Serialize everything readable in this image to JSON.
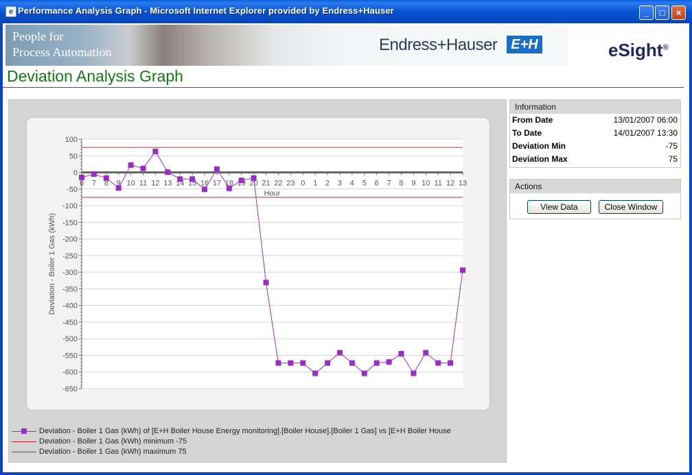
{
  "window": {
    "title": "Performance Analysis Graph - Microsoft Internet Explorer provided by Endress+Hauser",
    "minimize_glyph": "_",
    "maximize_glyph": "□",
    "close_glyph": "×",
    "ie_icon": "e"
  },
  "banner": {
    "slogan_line1": "People for",
    "slogan_line2": "Process Automation",
    "brand": "Endress+Hauser",
    "brand_logo": "E+H",
    "product": "eSight",
    "product_mark": "®"
  },
  "page_title": "Deviation Analysis Graph",
  "information": {
    "heading": "Information",
    "rows": [
      {
        "label": "From Date",
        "value": "13/01/2007 06:00"
      },
      {
        "label": "To Date",
        "value": "14/01/2007 13:30"
      },
      {
        "label": "Deviation Min",
        "value": "-75"
      },
      {
        "label": "Deviation Max",
        "value": "75"
      }
    ]
  },
  "actions": {
    "heading": "Actions",
    "view_data": "View Data",
    "close_window": "Close Window"
  },
  "colors": {
    "series": "#9a2ec4",
    "limit": "#cc2222",
    "title_green": "#117a11"
  },
  "chart_data": {
    "type": "line",
    "xlabel": "Hour",
    "ylabel": "Deviation -  Boiler 1 Gas (kWh)",
    "ylim": [
      -650,
      100
    ],
    "ytick_step": 50,
    "grid": true,
    "x": [
      "6",
      "7",
      "8",
      "9",
      "10",
      "11",
      "12",
      "13",
      "14",
      "15",
      "16",
      "17",
      "18",
      "19",
      "20",
      "21",
      "22",
      "23",
      "0",
      "1",
      "2",
      "3",
      "4",
      "5",
      "6",
      "7",
      "8",
      "9",
      "10",
      "11",
      "12",
      "13"
    ],
    "series": [
      {
        "name": "Deviation -  Boiler 1 Gas (kWh) of [E+H Boiler House Energy monitoring].[Boiler House].[Boiler 1 Gas] vs [E+H Boiler House",
        "values": [
          -15,
          -5,
          -17,
          -47,
          22,
          12,
          63,
          1,
          -20,
          -20,
          -51,
          10,
          -48,
          -24,
          -17,
          -331,
          -573,
          -573,
          -573,
          -604,
          -573,
          -542,
          -573,
          -604,
          -573,
          -570,
          -545,
          -604,
          -542,
          -573,
          -573,
          -294
        ]
      }
    ],
    "limits": [
      {
        "name": "Deviation -  Boiler 1 Gas (kWh) minimum -75",
        "value": -75
      },
      {
        "name": "Deviation -  Boiler 1 Gas (kWh) maximum 75",
        "value": 75
      }
    ]
  }
}
